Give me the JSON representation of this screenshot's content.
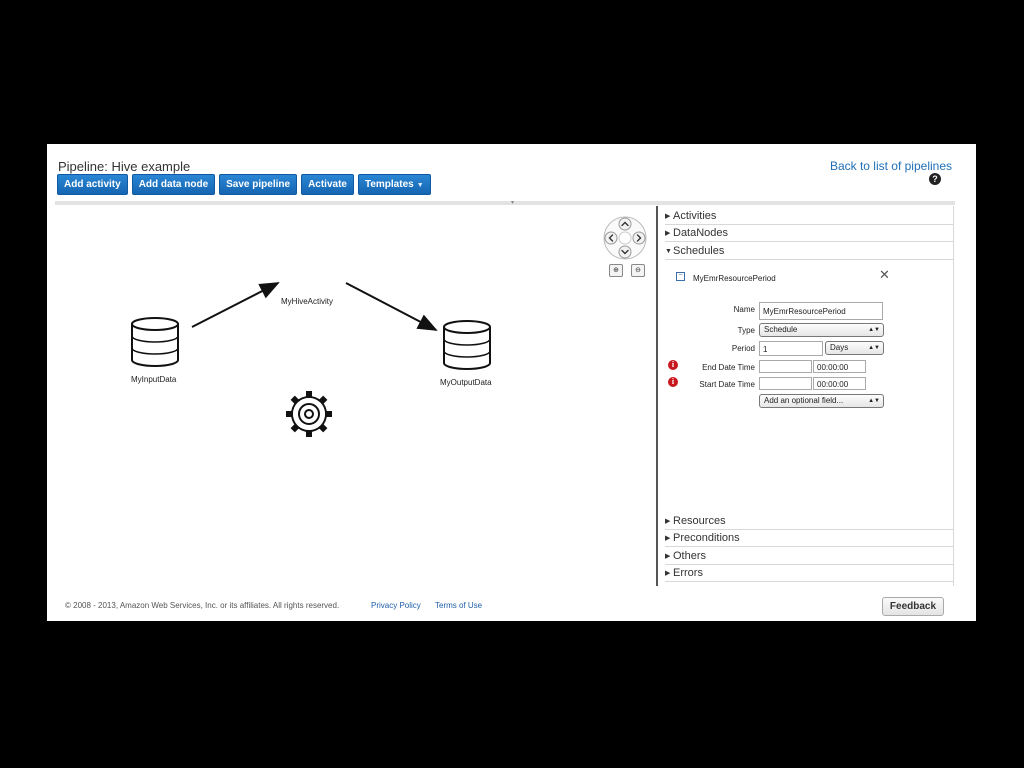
{
  "header": {
    "title": "Pipeline: Hive example",
    "back_link": "Back to list of pipelines",
    "help_glyph": "?"
  },
  "toolbar": {
    "add_activity": "Add activity",
    "add_data_node": "Add data node",
    "save_pipeline": "Save pipeline",
    "activate": "Activate",
    "templates": "Templates"
  },
  "graph": {
    "input_node": "MyInputData",
    "activity_node": "MyHiveActivity",
    "output_node": "MyOutputData"
  },
  "panel": {
    "sections_top": [
      "Activities",
      "DataNodes",
      "Schedules"
    ],
    "sections_bottom": [
      "Resources",
      "Preconditions",
      "Others",
      "Errors"
    ],
    "object": {
      "name": "MyEmrResourcePeriod",
      "fields": {
        "name_label": "Name",
        "name_value": "MyEmrResourcePeriod",
        "type_label": "Type",
        "type_value": "Schedule",
        "period_label": "Period",
        "period_value": "1",
        "period_unit": "Days",
        "end_label": "End Date Time",
        "end_date": "",
        "end_time": "00:00:00",
        "start_label": "Start Date Time",
        "start_date": "",
        "start_time": "00:00:00",
        "optional_field": "Add an optional field..."
      }
    }
  },
  "footer": {
    "copyright": "© 2008 - 2013, Amazon Web Services, Inc. or its affiliates. All rights reserved.",
    "privacy": "Privacy Policy",
    "terms": "Terms of Use",
    "feedback": "Feedback"
  },
  "colors": {
    "button_blue": "#1b73c2",
    "link_blue": "#1f6fb6",
    "error_red": "#c8181f"
  }
}
